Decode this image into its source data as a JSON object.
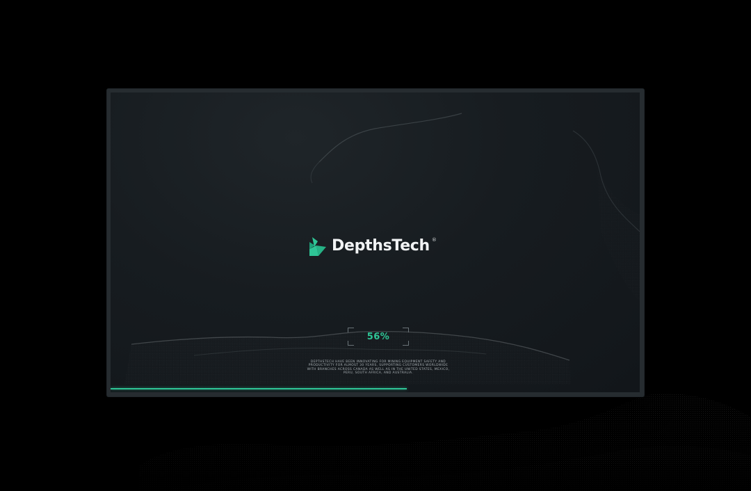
{
  "brand": {
    "name": "DepthsTech",
    "registered_mark": "®",
    "accent_color": "#2fc596",
    "logo_icon": "leaf-folded-triangles-icon"
  },
  "loader": {
    "progress_label": "56%",
    "progress_value": 0.56
  },
  "description": "DEPTHSTECH HAVE BEEN INNOVATING FOR MINING EQUIPMENT SAFETY AND PRODUCTIVITY FOR ALMOST 30 YEARS, SUPPORTING CUSTOMERS WORLDWIDE WITH BRANCHES ACROSS CANADA AS WELL AS IN THE UNITED STATES, MEXICO, PERU, SOUTH AFRICA, AND AUSTRALIA.",
  "colors": {
    "background": "#000000",
    "screen": "#171c20",
    "bezel": "#262c30",
    "text": "#f1f3f4"
  }
}
